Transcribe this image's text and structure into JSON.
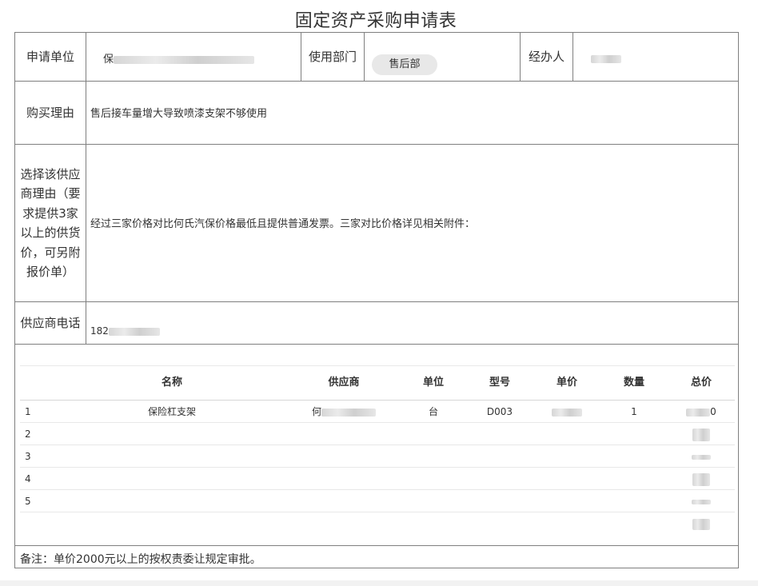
{
  "title": "固定资产采购申请表",
  "header": {
    "applicant_unit_label": "申请单位",
    "applicant_unit_value": "保",
    "department_label": "使用部门",
    "department_value": "售后部",
    "handler_label": "经办人"
  },
  "reason": {
    "label": "购买理由",
    "value": "售后接车量增大导致喷漆支架不够使用"
  },
  "supplier_reason": {
    "label": "选择该供应商理由（要求提供3家以上的供货价，可另附报价单）",
    "value": "经过三家价格对比何氏汽保价格最低且提供普通发票。三家对比价格详见相关附件："
  },
  "supplier_phone": {
    "label": "供应商电话",
    "value": "182"
  },
  "table": {
    "headers": [
      "名称",
      "供应商",
      "单位",
      "型号",
      "单价",
      "数量",
      "总价"
    ],
    "rows": [
      {
        "index": "1",
        "name": "保险杠支架",
        "supplier": "何",
        "unit": "台",
        "model": "D003",
        "qty": "1",
        "total_suffix": "0"
      },
      {
        "index": "2"
      },
      {
        "index": "3"
      },
      {
        "index": "4"
      },
      {
        "index": "5"
      }
    ]
  },
  "note": "备注：单价2000元以上的按权责委让规定审批。"
}
